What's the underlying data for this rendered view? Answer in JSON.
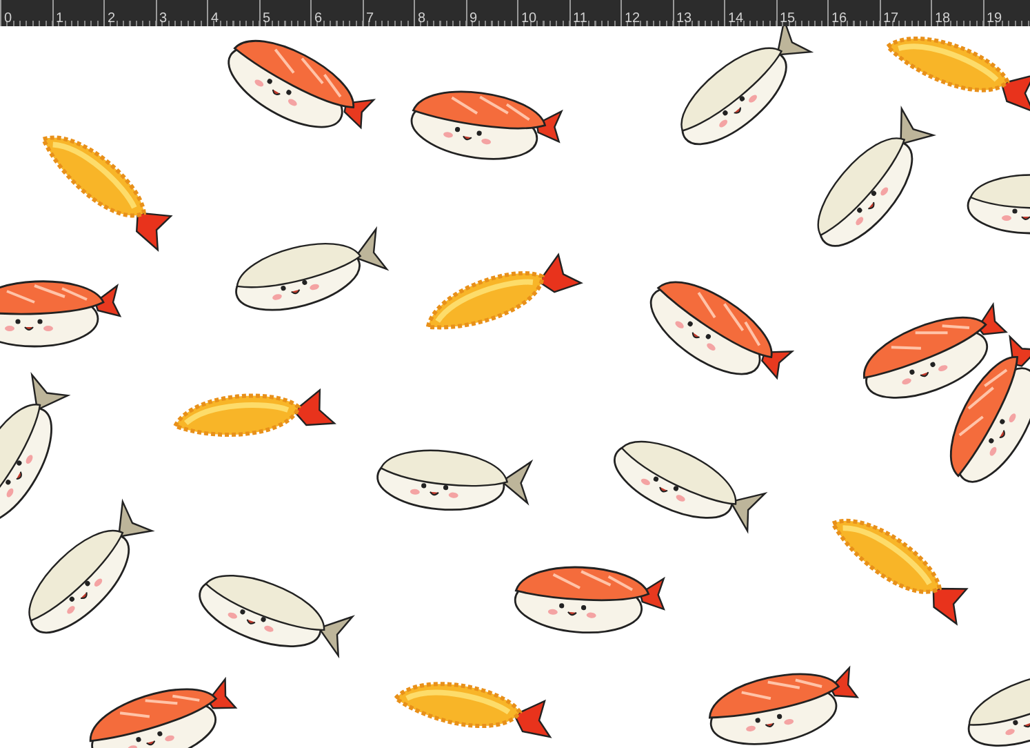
{
  "ruler": {
    "labels": [
      "0",
      "1",
      "2",
      "3",
      "4",
      "5",
      "6",
      "7",
      "8",
      "9",
      "10",
      "11",
      "12",
      "13",
      "14",
      "15",
      "16",
      "17",
      "18",
      "19"
    ]
  }
}
